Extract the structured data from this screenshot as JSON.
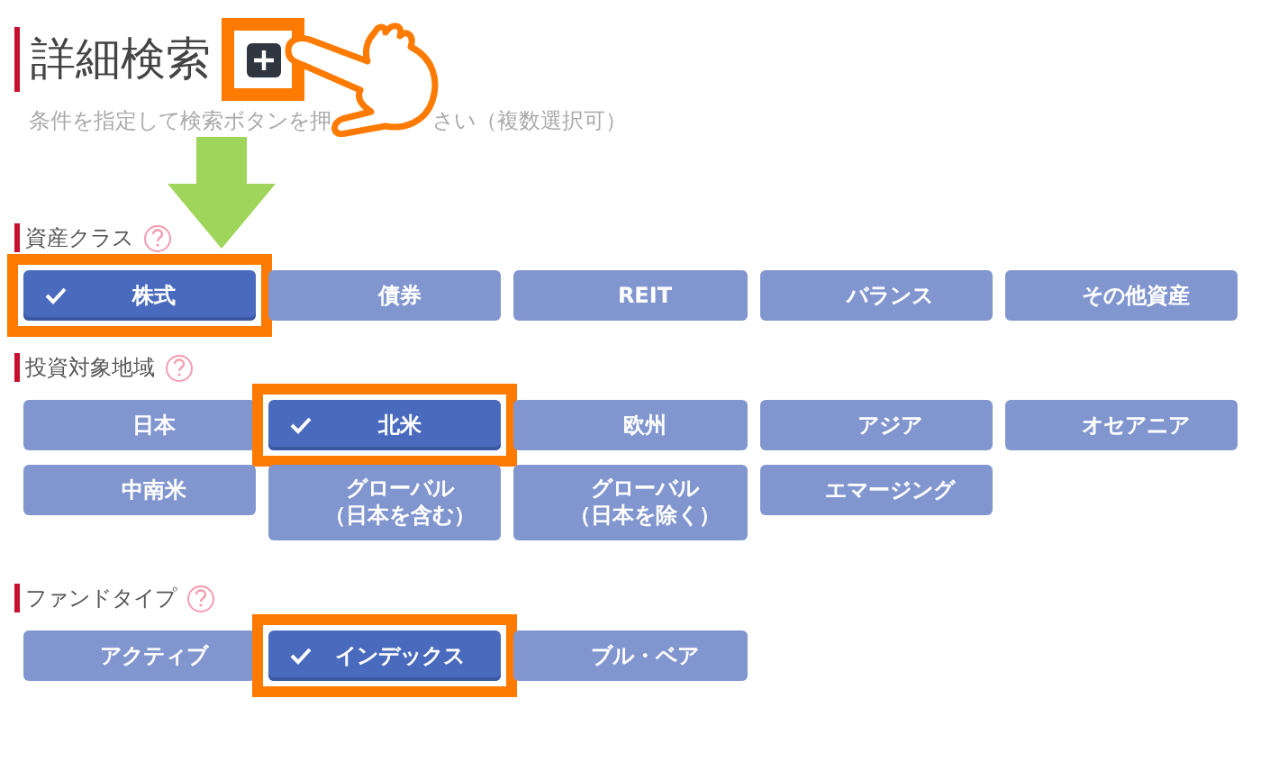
{
  "header": {
    "title": "詳細検索",
    "subtitle_parts": [
      "条件を指定して検索ボタンを押",
      "さい（複数選択可）"
    ]
  },
  "sections": [
    {
      "label": "資産クラス",
      "options": [
        {
          "label": "株式",
          "selected": true
        },
        {
          "label": "債券",
          "selected": false
        },
        {
          "label": "REIT",
          "selected": false
        },
        {
          "label": "バランス",
          "selected": false
        },
        {
          "label": "その他資産",
          "selected": false
        }
      ]
    },
    {
      "label": "投資対象地域",
      "options": [
        {
          "label": "日本",
          "selected": false
        },
        {
          "label": "北米",
          "selected": true
        },
        {
          "label": "欧州",
          "selected": false
        },
        {
          "label": "アジア",
          "selected": false
        },
        {
          "label": "オセアニア",
          "selected": false
        },
        {
          "label": "中南米",
          "selected": false
        },
        {
          "lines": [
            "グローバル",
            "（日本を含む）"
          ],
          "selected": false
        },
        {
          "lines": [
            "グローバル",
            "（日本を除く）"
          ],
          "selected": false
        },
        {
          "label": "エマージング",
          "selected": false
        }
      ]
    },
    {
      "label": "ファンドタイプ",
      "options": [
        {
          "label": "アクティブ",
          "selected": false
        },
        {
          "label": "インデックス",
          "selected": true
        },
        {
          "label": "ブル・ベア",
          "selected": false
        }
      ]
    }
  ]
}
